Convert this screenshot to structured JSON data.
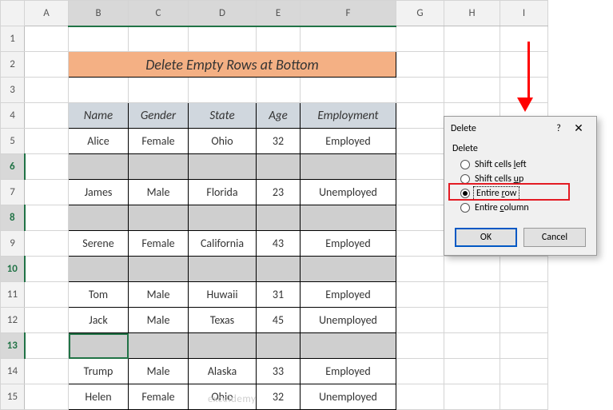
{
  "columns": [
    "A",
    "B",
    "C",
    "D",
    "E",
    "F",
    "G",
    "H",
    "I"
  ],
  "row_count": 15,
  "selected_rows": [
    6,
    8,
    10,
    13
  ],
  "selected_cols": [
    "B",
    "C",
    "D",
    "E",
    "F"
  ],
  "title": "Delete Empty Rows at Bottom",
  "headers": {
    "B": "Name",
    "C": "Gender",
    "D": "State",
    "E": "Age",
    "F": "Employment"
  },
  "data": {
    "5": {
      "B": "Alice",
      "C": "Female",
      "D": "Ohio",
      "E": "32",
      "F": "Employed"
    },
    "6": {
      "B": "",
      "C": "",
      "D": "",
      "E": "",
      "F": ""
    },
    "7": {
      "B": "James",
      "C": "Male",
      "D": "Florida",
      "E": "23",
      "F": "Unemployed"
    },
    "8": {
      "B": "",
      "C": "",
      "D": "",
      "E": "",
      "F": ""
    },
    "9": {
      "B": "Serene",
      "C": "Female",
      "D": "California",
      "E": "43",
      "F": "Employed"
    },
    "10": {
      "B": "",
      "C": "",
      "D": "",
      "E": "",
      "F": ""
    },
    "11": {
      "B": "Tom",
      "C": "Male",
      "D": "Huwaii",
      "E": "31",
      "F": "Employed"
    },
    "12": {
      "B": "Jack",
      "C": "Male",
      "D": "Texas",
      "E": "45",
      "F": "Unemployed"
    },
    "13": {
      "B": "",
      "C": "",
      "D": "",
      "E": "",
      "F": ""
    },
    "14": {
      "B": "Trump",
      "C": "Male",
      "D": "Alaska",
      "E": "33",
      "F": "Employed"
    },
    "15": {
      "B": "Helen",
      "C": "Female",
      "D": "Ohio",
      "E": "32",
      "F": "Unemployed"
    }
  },
  "dialog": {
    "title": "Delete",
    "help_symbol": "?",
    "close_symbol": "✕",
    "group_label": "Delete",
    "options": {
      "shift_left": {
        "pre": "Shift cells ",
        "u": "l",
        "post": "eft"
      },
      "shift_up": {
        "pre": "Shift cells ",
        "u": "u",
        "post": "p"
      },
      "entire_row": {
        "pre": "Entire ",
        "u": "r",
        "post": "ow"
      },
      "entire_col": {
        "pre": "Entire ",
        "u": "c",
        "post": "olumn"
      }
    },
    "selected": "entire_row",
    "ok": "OK",
    "cancel": "Cancel"
  },
  "watermark": "exceldemy"
}
